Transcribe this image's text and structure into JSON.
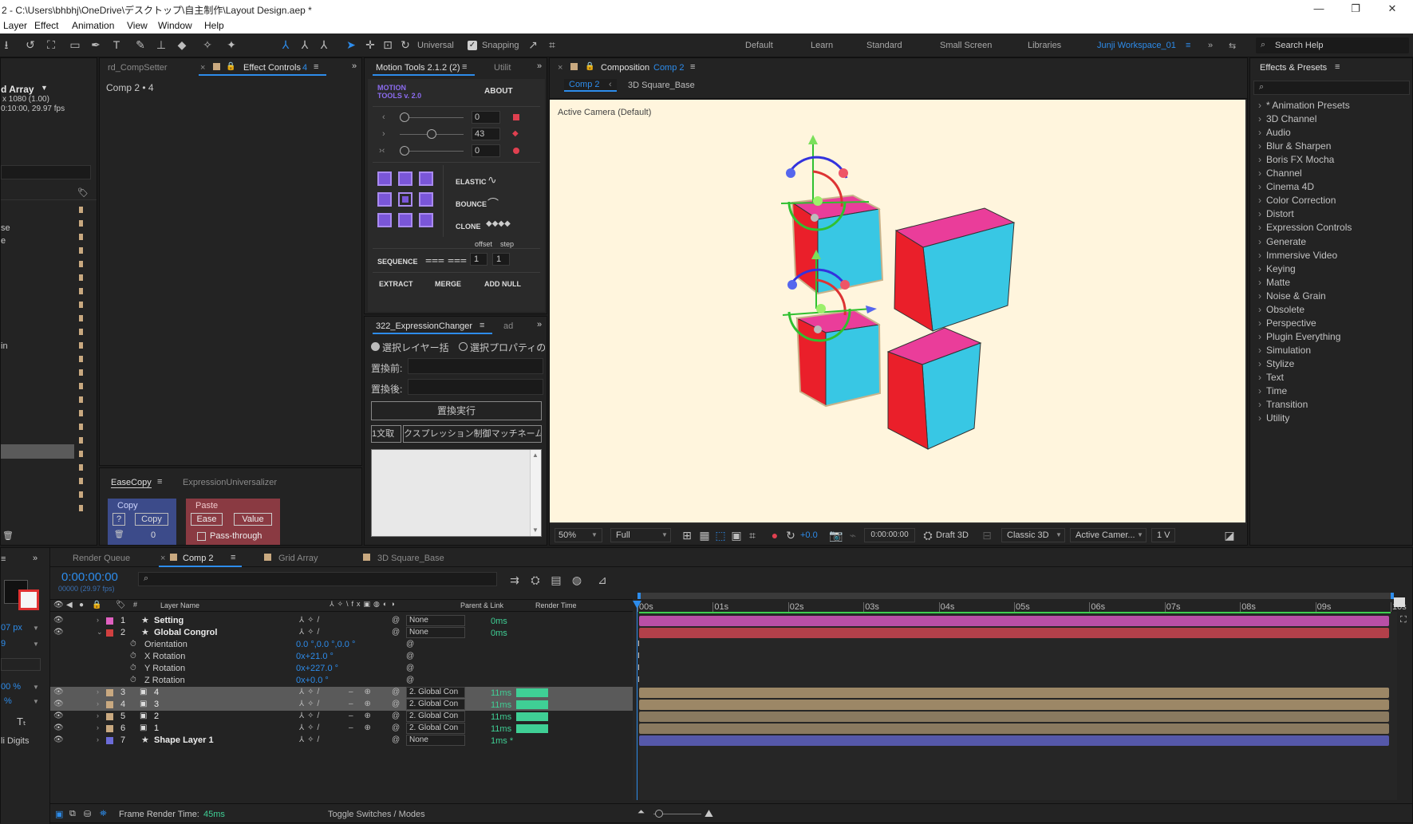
{
  "window": {
    "title": "2 - C:\\Users\\bhbhj\\OneDrive\\デスクトップ\\自主制作\\Layout Design.aep *",
    "minimize": "—",
    "maximize": "❐",
    "close": "✕"
  },
  "menu": [
    "Layer",
    "Effect",
    "Animation",
    "View",
    "Window",
    "Help"
  ],
  "toolbar": {
    "axis_mode": "Universal",
    "snapping": "Snapping",
    "workspaces": [
      "Default",
      "Learn",
      "Standard",
      "Small Screen",
      "Libraries",
      "Junji Workspace_01"
    ],
    "search_help": "Search Help"
  },
  "project_panel": {
    "comp_name": "d Array",
    "size": "x 1080 (1.00)",
    "duration": "0:10:00, 29.97 fps",
    "items": [
      "se",
      "e",
      "in"
    ]
  },
  "effect_controls": {
    "tab1": "rd_CompSetter",
    "tab2": "Effect Controls",
    "tab2_count": "4",
    "header": "Comp 2 • 4"
  },
  "motion_tools": {
    "tab": "Motion Tools 2.1.2 (2)",
    "tab2": "Utilit",
    "logo_line1": "MOTION",
    "logo_line2": "TOOLS v. 2.0",
    "about": "ABOUT",
    "sliders": [
      {
        "icon": "‹",
        "value": "0",
        "level": 0
      },
      {
        "icon": "›",
        "value": "43",
        "level": 43
      },
      {
        "icon": "›‹",
        "value": "0",
        "level": 0
      }
    ],
    "elastic": "ELASTIC",
    "bounce": "BOUNCE",
    "clone": "CLONE",
    "offset": "offset",
    "step": "step",
    "sequence": "SEQUENCE",
    "seq_offset": "1",
    "seq_step": "1",
    "extract": "EXTRACT",
    "merge": "MERGE",
    "add_null": "ADD NULL"
  },
  "expression_changer": {
    "tab": "322_ExpressionChanger",
    "tab2": "ad",
    "radio1": "選択レイヤー括",
    "radio2": "選択プロパティの",
    "before_label": "置換前:",
    "after_label": "置換後:",
    "run_button": "置換実行",
    "opt1": "1文取",
    "opt2": "クスプレッション制御マッチネーム"
  },
  "easecopy": {
    "tab": "EaseCopy",
    "tab2": "ExpressionUniversalizer",
    "copy_label": "Copy",
    "question": "?",
    "copy_btn": "Copy",
    "count": "0",
    "paste_label": "Paste",
    "ease_btn": "Ease",
    "value_btn": "Value",
    "pass_through": "Pass-through"
  },
  "composition": {
    "tab_prefix": "Composition",
    "tab_name": "Comp 2",
    "breadcrumb1": "Comp 2",
    "breadcrumb2": "3D Square_Base",
    "camera_label": "Active Camera (Default)",
    "bg_color": "#fff5dd",
    "zoom": "50%",
    "resolution": "Full",
    "exposure": "+0.0",
    "timecode": "0:00:00:00",
    "draft": "Draft 3D",
    "renderer": "Classic 3D",
    "camera": "Active Camer...",
    "views": "1 V"
  },
  "effects_presets": {
    "title": "Effects & Presets",
    "items": [
      "* Animation Presets",
      "3D Channel",
      "Audio",
      "Blur & Sharpen",
      "Boris FX Mocha",
      "Channel",
      "Cinema 4D",
      "Color Correction",
      "Distort",
      "Expression Controls",
      "Generate",
      "Immersive Video",
      "Keying",
      "Matte",
      "Noise & Grain",
      "Obsolete",
      "Perspective",
      "Plugin Everything",
      "Simulation",
      "Stylize",
      "Text",
      "Time",
      "Transition",
      "Utility"
    ]
  },
  "timeline": {
    "tabs": [
      "Render Queue",
      "Comp 2",
      "Grid Array",
      "3D Square_Base"
    ],
    "timecode": "0:00:00:00",
    "frames": "00000 (29.97 fps)",
    "col_layer_name": "Layer Name",
    "col_parent": "Parent & Link",
    "col_render_time": "Render Time",
    "ruler": [
      "00s",
      "01s",
      "02s",
      "03s",
      "04s",
      "05s",
      "06s",
      "07s",
      "08s",
      "09s",
      "10s"
    ],
    "layers": [
      {
        "num": "1",
        "name": "Setting",
        "color": "#e060c0",
        "star": true,
        "parent": "None",
        "rt": "0ms",
        "bar": "#b94fa6",
        "bold": true
      },
      {
        "num": "2",
        "name": "Global Congrol",
        "color": "#d04040",
        "star": true,
        "parent": "None",
        "rt": "0ms",
        "bar": "#b2404a",
        "bold": true,
        "open": true
      },
      {
        "num": "3",
        "name": "4",
        "color": "#c9a980",
        "star": false,
        "parent": "2. Global Con",
        "rt": "11ms",
        "bar": "#9c8766",
        "sel": true
      },
      {
        "num": "4",
        "name": "3",
        "color": "#c9a980",
        "star": false,
        "parent": "2. Global Con",
        "rt": "11ms",
        "bar": "#9c8766",
        "sel": true
      },
      {
        "num": "5",
        "name": "2",
        "color": "#c9a980",
        "star": false,
        "parent": "2. Global Con",
        "rt": "11ms",
        "bar": "#8a7a60"
      },
      {
        "num": "6",
        "name": "1",
        "color": "#c9a980",
        "star": false,
        "parent": "2. Global Con",
        "rt": "11ms",
        "bar": "#8a7a60"
      },
      {
        "num": "7",
        "name": "Shape Layer 1",
        "color": "#6c6cd8",
        "star": true,
        "parent": "None",
        "rt": "1ms *",
        "bar": "#5558aa",
        "bold": true
      }
    ],
    "props": [
      {
        "name": "Orientation",
        "value": "0.0 °,0.0 °,0.0 °"
      },
      {
        "name": "X Rotation",
        "value": "0x+21.0 °"
      },
      {
        "name": "Y Rotation",
        "value": "0x+227.0 °"
      },
      {
        "name": "Z Rotation",
        "value": "0x+0.0 °"
      }
    ],
    "frame_render_label": "Frame Render Time:",
    "frame_render_value": "45ms",
    "toggle": "Toggle Switches / Modes"
  },
  "left_strip": {
    "px": "07 px",
    "v9": "9",
    "pct1": "00 %",
    "pct2": "%",
    "digits": "li Digits"
  }
}
